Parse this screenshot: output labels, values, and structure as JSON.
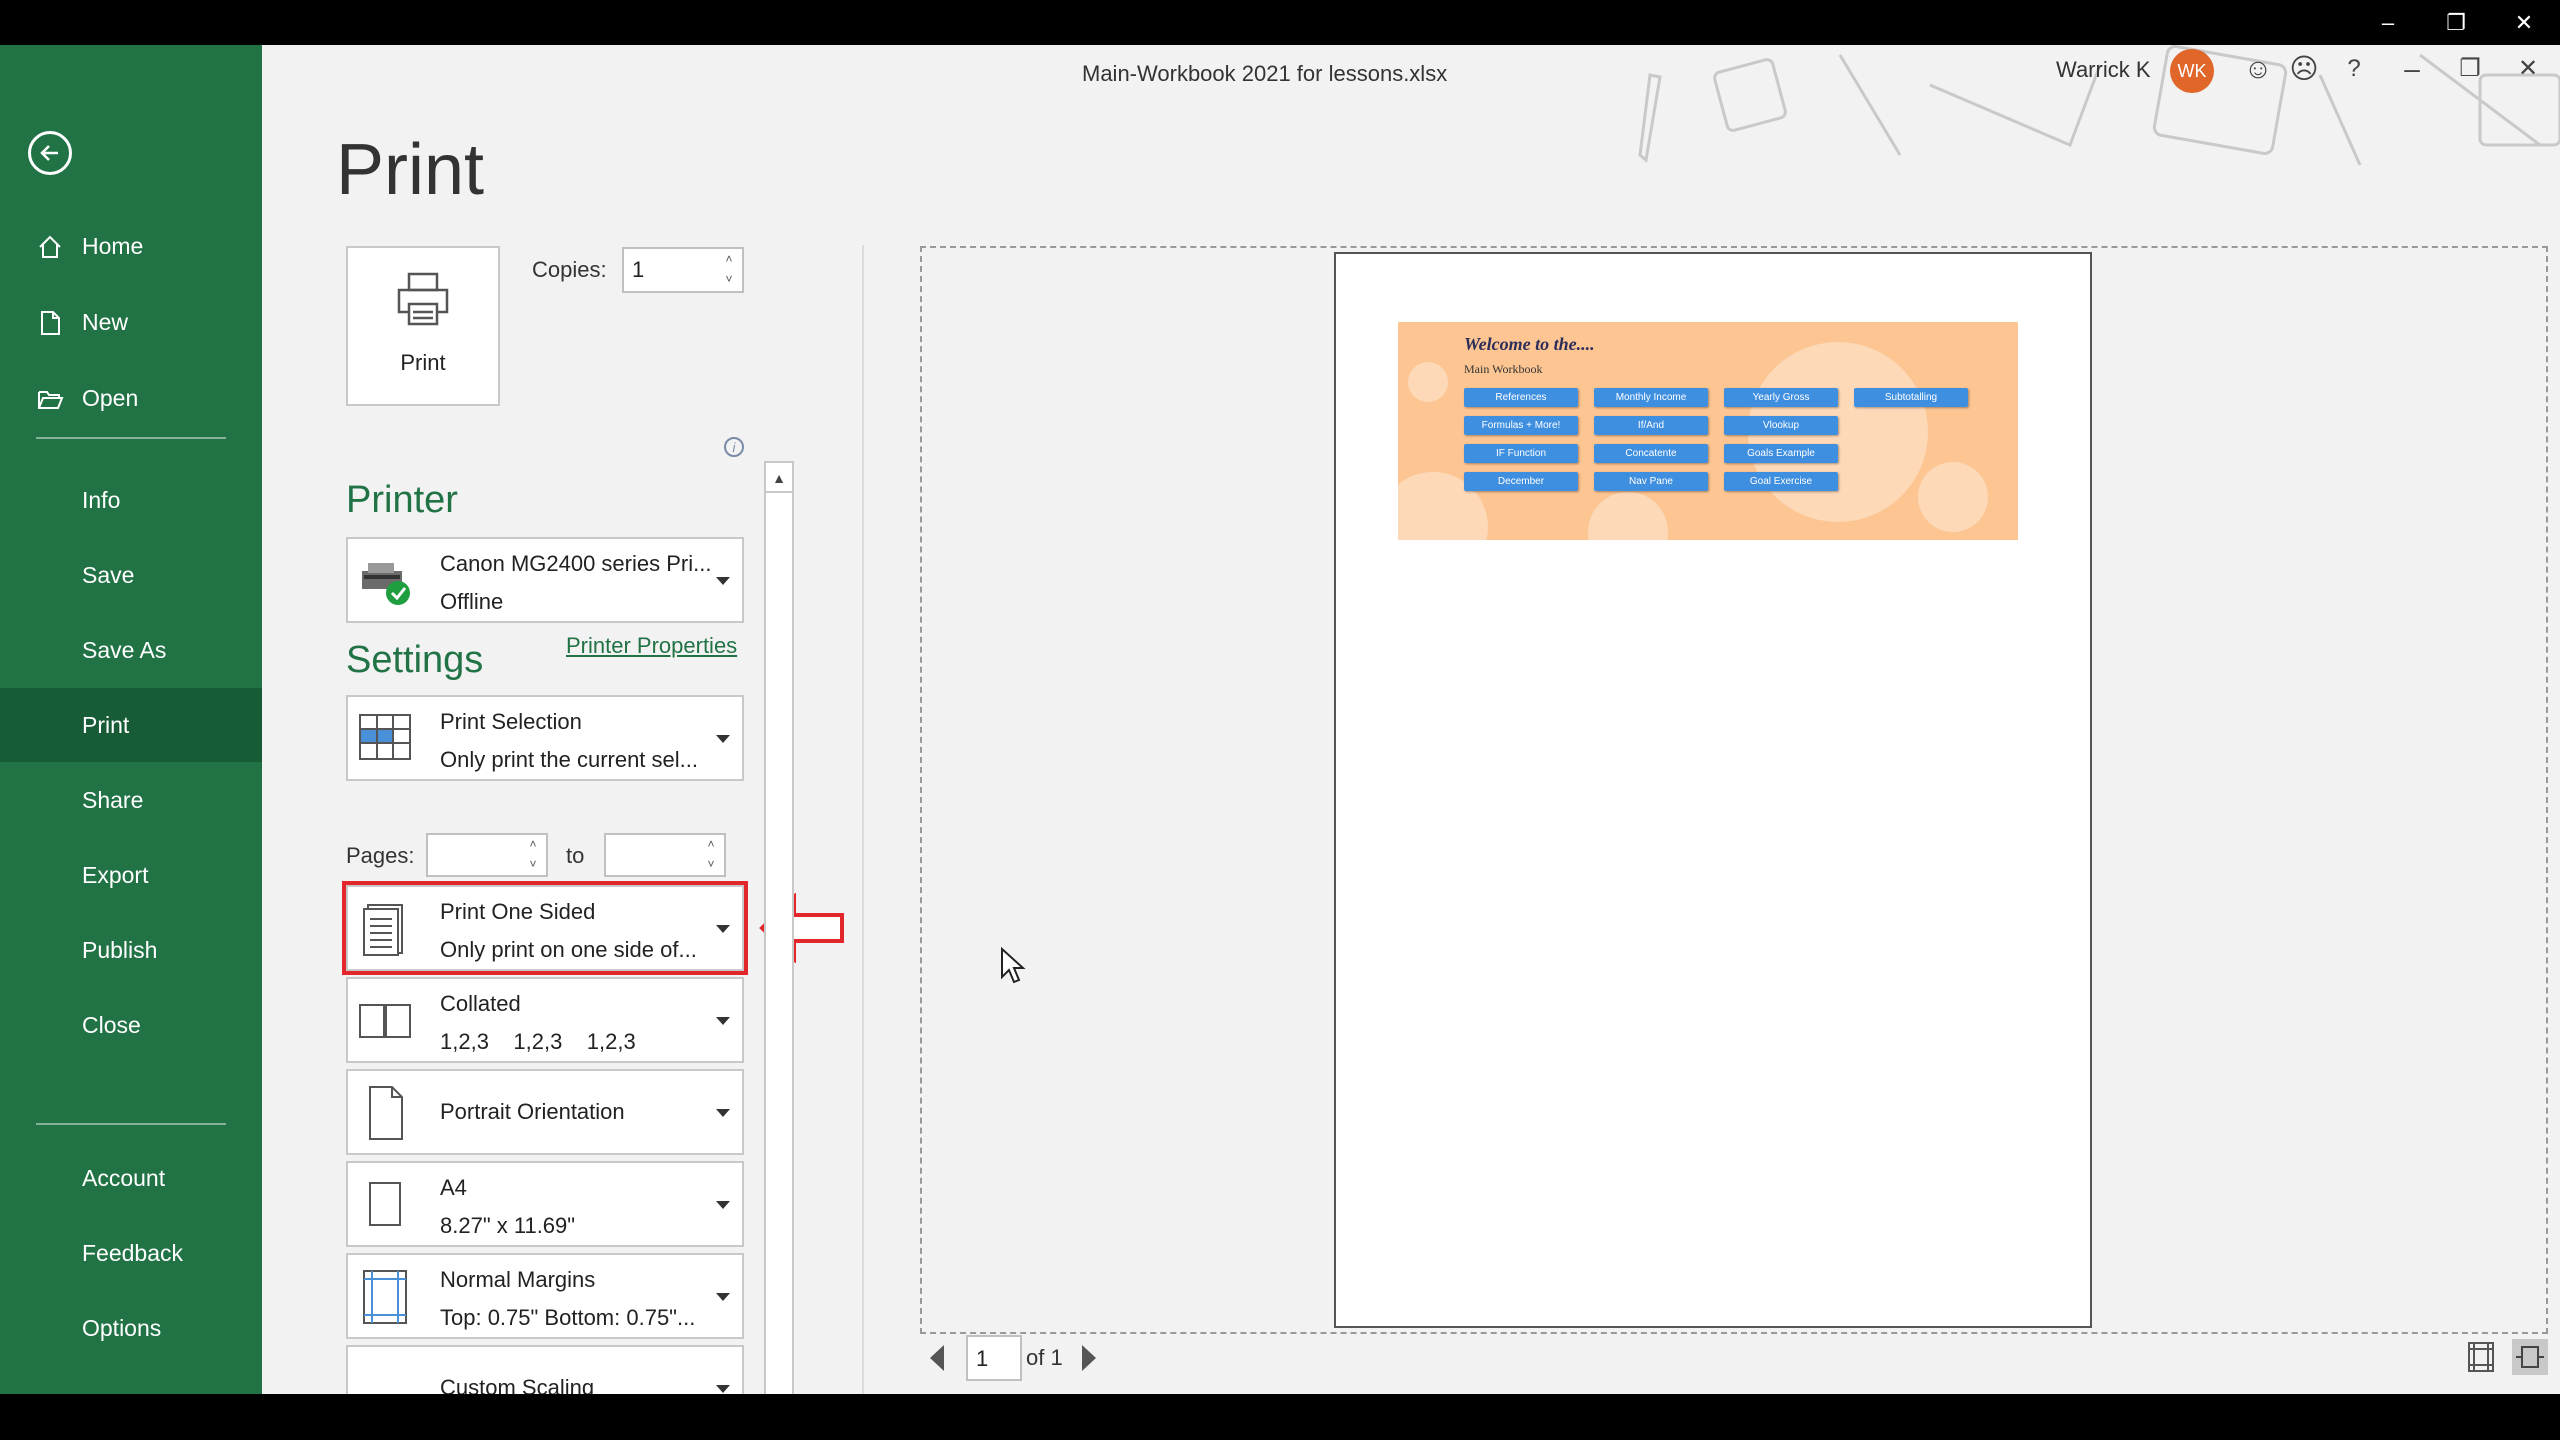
{
  "window": {
    "title": "Main-Workbook 2021 for lessons.xlsx",
    "user_name": "Warrick K",
    "user_initials": "WK",
    "os_controls": [
      "minimize-icon",
      "restore-icon",
      "close-icon"
    ],
    "app_controls": [
      "smile-icon",
      "frown-icon",
      "help-icon",
      "minimize-icon",
      "restore-icon",
      "close-icon"
    ],
    "help_glyph": "?"
  },
  "sidebar": {
    "top_items": [
      {
        "label": "Home",
        "icon": "home-icon"
      },
      {
        "label": "New",
        "icon": "new-file-icon"
      },
      {
        "label": "Open",
        "icon": "open-folder-icon"
      }
    ],
    "mid_items": [
      {
        "label": "Info"
      },
      {
        "label": "Save"
      },
      {
        "label": "Save As"
      },
      {
        "label": "Print",
        "active": true
      },
      {
        "label": "Share"
      },
      {
        "label": "Export"
      },
      {
        "label": "Publish"
      },
      {
        "label": "Close"
      }
    ],
    "bottom_items": [
      {
        "label": "Account"
      },
      {
        "label": "Feedback"
      },
      {
        "label": "Options"
      }
    ]
  },
  "print": {
    "page_title": "Print",
    "print_button_label": "Print",
    "copies_label": "Copies:",
    "copies_value": "1"
  },
  "printer": {
    "section_title": "Printer",
    "name": "Canon MG2400 series Pri...",
    "status": "Offline",
    "properties_link": "Printer Properties",
    "info_glyph": "i"
  },
  "settings": {
    "section_title": "Settings",
    "print_what": {
      "line1": "Print Selection",
      "line2": "Only print the current sel..."
    },
    "pages_label": "Pages:",
    "pages_from": "",
    "pages_to": "",
    "to_label": "to",
    "sides": {
      "line1": "Print One Sided",
      "line2": "Only print on one side of..."
    },
    "collation": {
      "line1": "Collated",
      "line2": "1,2,3    1,2,3    1,2,3"
    },
    "orientation": {
      "line1": "Portrait Orientation"
    },
    "paper": {
      "line1": "A4",
      "line2": "8.27\" x 11.69\""
    },
    "margins": {
      "line1": "Normal Margins",
      "line2": "Top: 0.75\" Bottom: 0.75\"..."
    },
    "scaling": {
      "line1": "Custom Scaling"
    }
  },
  "preview": {
    "sheet_title": "Welcome to the....",
    "sheet_subtitle": "Main Workbook",
    "sheet_buttons": [
      "References",
      "Monthly Income",
      "Yearly Gross",
      "Subtotalling",
      "Formulas + More!",
      "If/And",
      "Vlookup",
      "IF Function",
      "Concatente",
      "Goals Example",
      "December",
      "Nav Pane",
      "Goal Exercise"
    ],
    "sheet_bg_color": "#fcc592",
    "sheet_btn_color": "#3f8fe0"
  },
  "page_nav": {
    "current_page": "1",
    "of_label": "of 1"
  },
  "colors": {
    "excel_green": "#217346",
    "excel_green_dark": "#185c37",
    "highlight_red": "#e3262c"
  }
}
